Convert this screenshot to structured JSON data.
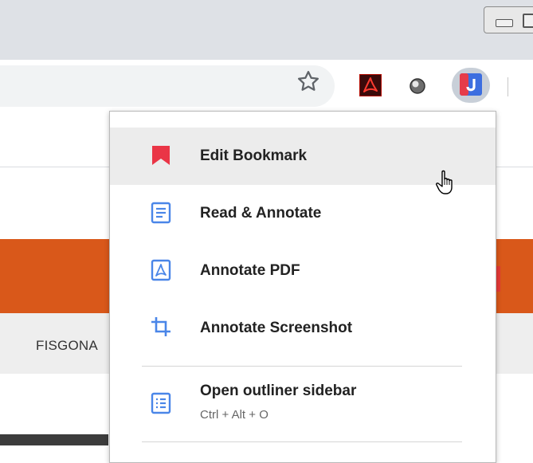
{
  "browser": {
    "toolbar": {
      "bookmark_star": "star-icon",
      "extensions": [
        "adobe-acrobat-icon",
        "circle-extension-icon",
        "hypothesis-icon"
      ]
    }
  },
  "page": {
    "nav_item": "FISGONA"
  },
  "menu": {
    "items": [
      {
        "label": "Edit Bookmark",
        "icon": "bookmark-icon",
        "color": "#ea3546"
      },
      {
        "label": "Read & Annotate",
        "icon": "document-icon",
        "color": "#4a86e8"
      },
      {
        "label": "Annotate PDF",
        "icon": "pdf-icon",
        "color": "#4a86e8"
      },
      {
        "label": "Annotate Screenshot",
        "icon": "crop-icon",
        "color": "#4a86e8"
      },
      {
        "label": "Open outliner sidebar",
        "shortcut": "Ctrl + Alt + O",
        "icon": "outline-list-icon",
        "color": "#4a86e8"
      }
    ]
  }
}
